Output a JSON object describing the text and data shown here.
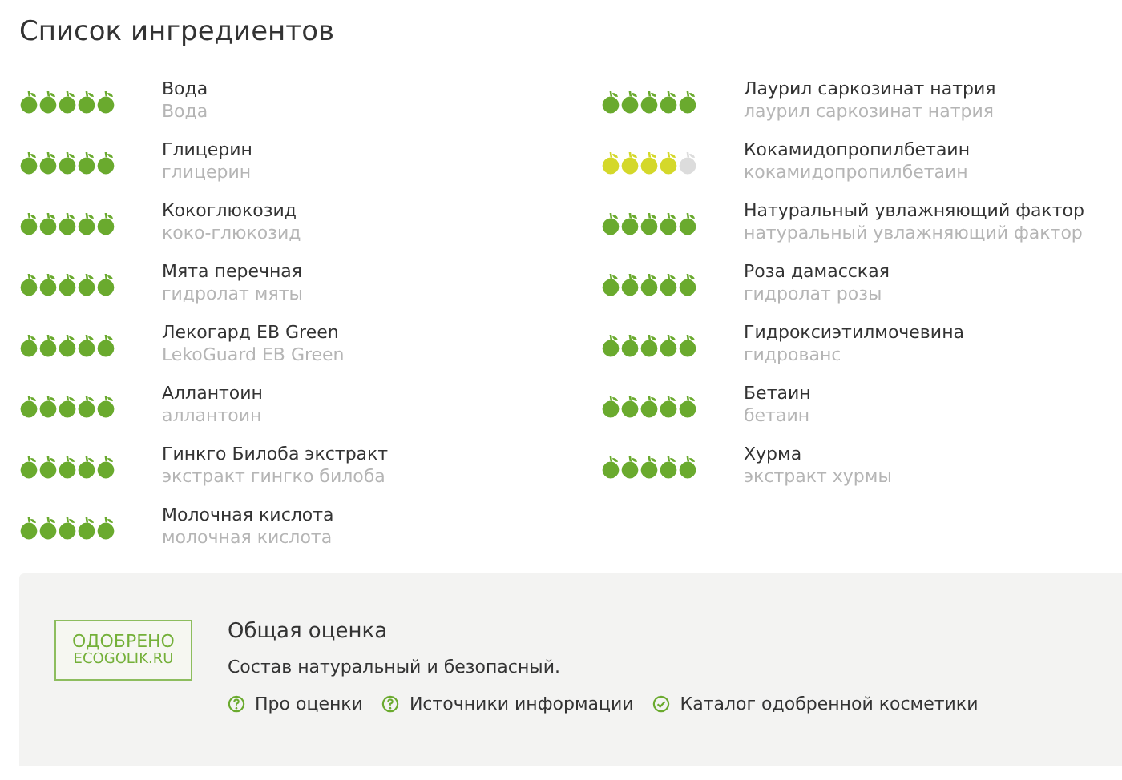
{
  "title": "Список ингредиентов",
  "columns": [
    [
      {
        "name": "Вода",
        "inci": "Вода",
        "stars": 5,
        "color": "#6aaa2e"
      },
      {
        "name": "Глицерин",
        "inci": "глицерин",
        "stars": 5,
        "color": "#6aaa2e"
      },
      {
        "name": "Кокоглюкозид",
        "inci": "коко-глюкозид",
        "stars": 5,
        "color": "#6aaa2e"
      },
      {
        "name": "Мята перечная",
        "inci": "гидролат мяты",
        "stars": 5,
        "color": "#6aaa2e"
      },
      {
        "name": "Лекогард EB Green",
        "inci": "LekoGuard EB Green",
        "stars": 5,
        "color": "#6aaa2e"
      },
      {
        "name": "Аллантоин",
        "inci": "аллантоин",
        "stars": 5,
        "color": "#6aaa2e"
      },
      {
        "name": "Гинкго Билоба экстракт",
        "inci": "экстракт гингко билоба",
        "stars": 5,
        "color": "#6aaa2e"
      },
      {
        "name": "Молочная кислота",
        "inci": "молочная кислота",
        "stars": 5,
        "color": "#6aaa2e"
      }
    ],
    [
      {
        "name": "Лаурил саркозинат натрия",
        "inci": "лаурил саркозинат натрия",
        "stars": 5,
        "color": "#6aaa2e"
      },
      {
        "name": "Кокамидопропилбетаин",
        "inci": "кокамидопропилбетаин",
        "stars": 4,
        "color": "#d4d82a"
      },
      {
        "name": "Натуральный увлажняющий фактор",
        "inci": "натуральный увлажняющий фактор",
        "stars": 5,
        "color": "#6aaa2e"
      },
      {
        "name": "Роза дамасская",
        "inci": "гидролат розы",
        "stars": 5,
        "color": "#6aaa2e"
      },
      {
        "name": "Гидроксиэтилмочевина",
        "inci": "гидрованс",
        "stars": 5,
        "color": "#6aaa2e"
      },
      {
        "name": "Бетаин",
        "inci": "бетаин",
        "stars": 5,
        "color": "#6aaa2e"
      },
      {
        "name": "Хурма",
        "inci": "экстракт хурмы",
        "stars": 5,
        "color": "#6aaa2e"
      }
    ]
  ],
  "summary": {
    "badge": [
      "ОДОБРЕНО",
      "ECOGOLIK.RU"
    ],
    "heading": "Общая оценка",
    "text": "Состав натуральный и безопасный.",
    "links": [
      {
        "kind": "question",
        "label": "Про оценки"
      },
      {
        "kind": "question",
        "label": "Источники информации"
      },
      {
        "kind": "check",
        "label": "Каталог одобренной косметики"
      }
    ]
  }
}
